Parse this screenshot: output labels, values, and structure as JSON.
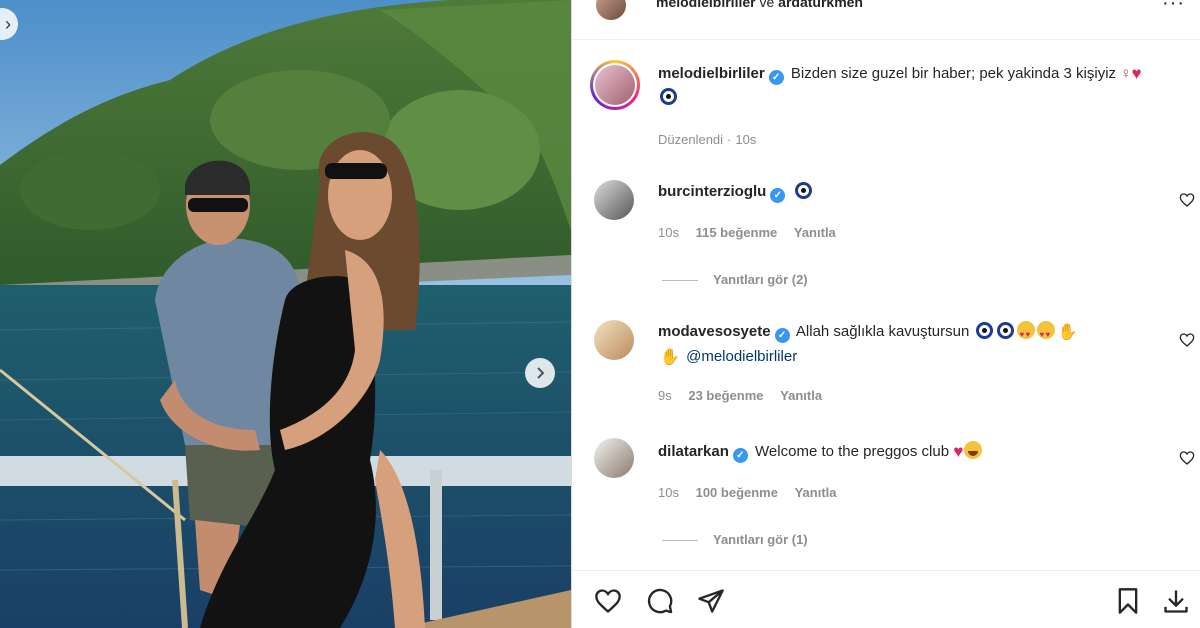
{
  "header": {
    "user1": "melodielbirliler",
    "and": "ve",
    "user2": "ardaturkmen"
  },
  "caption": {
    "username": "melodielbirliler",
    "text": "Bizden size guzel bir haber; pek yakinda 3 kişiyiz",
    "meta_edited": "Düzenlendi",
    "meta_sep": "·",
    "meta_time": "10s"
  },
  "comments": [
    {
      "username": "burcinterzioglu",
      "text": "",
      "time": "10s",
      "likes": "115 beğenme",
      "reply": "Yanıtla",
      "view_replies": "Yanıtları gör (2)"
    },
    {
      "username": "modavesosyete",
      "text": "Allah sağlıkla kavuştursun",
      "mention": "@melodielbirliler",
      "time": "9s",
      "likes": "23 beğenme",
      "reply": "Yanıtla"
    },
    {
      "username": "dilatarkan",
      "text": "Welcome to the preggos club",
      "time": "10s",
      "likes": "100 beğenme",
      "reply": "Yanıtla",
      "view_replies": "Yanıtları gör (1)"
    }
  ],
  "icons": {
    "like": "heart-icon",
    "comment": "comment-icon",
    "share": "share-icon",
    "save": "bookmark-icon",
    "download": "download-icon",
    "more": "more-icon",
    "prev": "chevron-left-icon",
    "next": "chevron-right-icon"
  },
  "colors": {
    "verified": "#3897f0",
    "mention": "#00376b",
    "muted": "#8e8e8e",
    "text": "#262626"
  }
}
